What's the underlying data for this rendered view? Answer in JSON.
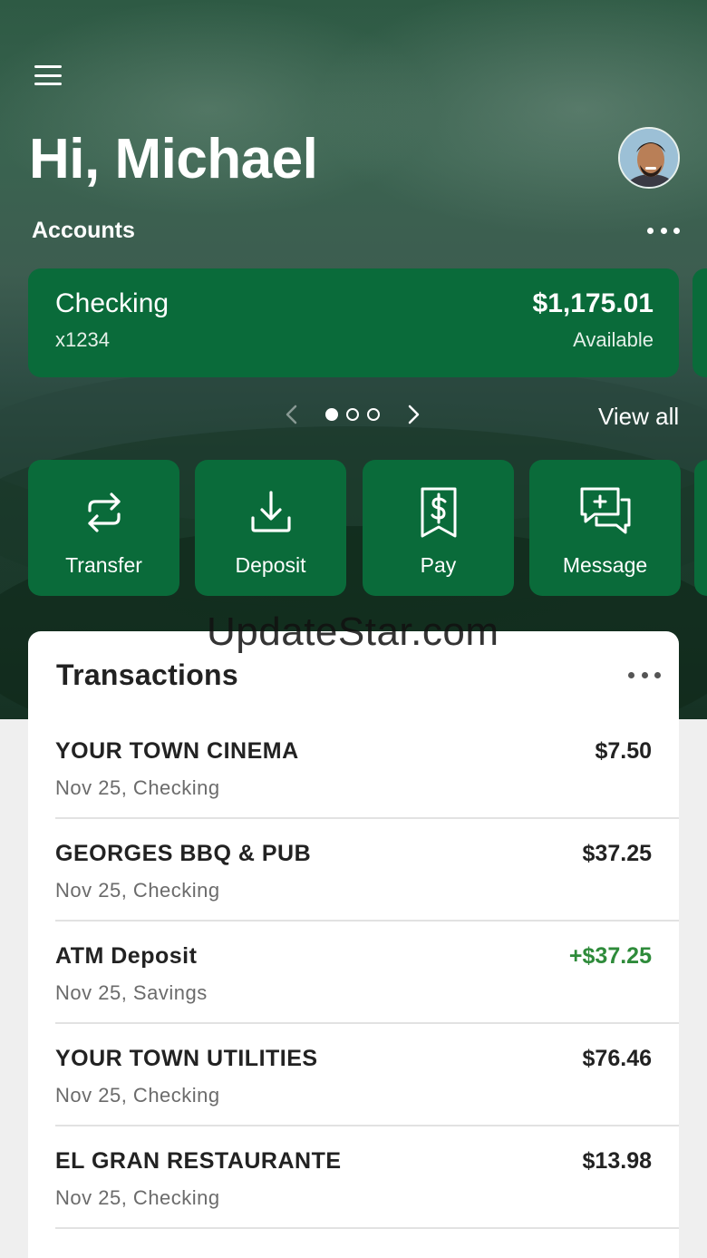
{
  "header": {
    "greeting": "Hi, Michael",
    "accounts_label": "Accounts"
  },
  "account": {
    "name": "Checking",
    "number": "x1234",
    "balance": "$1,175.01",
    "balance_label": "Available"
  },
  "pager": {
    "current_page": 1,
    "total_pages": 3,
    "view_all_label": "View all"
  },
  "actions": [
    {
      "label": "Transfer",
      "icon": "transfer-arrows-icon"
    },
    {
      "label": "Deposit",
      "icon": "download-tray-icon"
    },
    {
      "label": "Pay",
      "icon": "bill-dollar-icon"
    },
    {
      "label": "Message",
      "icon": "chat-plus-icon"
    }
  ],
  "watermark": "UpdateStar.com",
  "transactions": {
    "title": "Transactions",
    "items": [
      {
        "merchant": "YOUR TOWN CINEMA",
        "detail": "Nov 25, Checking",
        "amount": "$7.50"
      },
      {
        "merchant": "GEORGES BBQ & PUB",
        "detail": "Nov 25, Checking",
        "amount": "$37.25"
      },
      {
        "merchant": "ATM Deposit",
        "detail": "Nov 25, Savings",
        "amount": "+$37.25"
      },
      {
        "merchant": "YOUR TOWN UTILITIES",
        "detail": "Nov 25, Checking",
        "amount": "$76.46"
      },
      {
        "merchant": "EL GRAN RESTAURANTE",
        "detail": "Nov 25, Checking",
        "amount": "$13.98"
      }
    ]
  },
  "colors": {
    "brand_green": "#0a6b3a",
    "credit_green": "#2e8b3a"
  }
}
